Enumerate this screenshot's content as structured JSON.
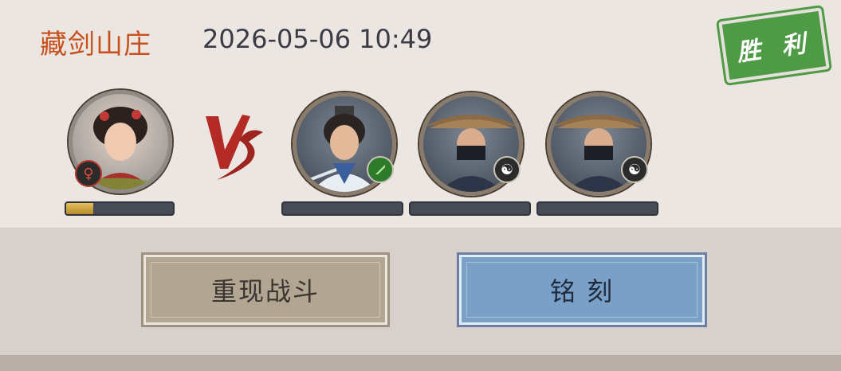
{
  "header": {
    "location": "藏剑山庄",
    "timestamp": "2026-05-06 10:49",
    "result_stamp": "胜 利"
  },
  "left_team": {
    "hero": {
      "icon": "heroine-portrait-icon",
      "badge": "♀",
      "badge_icon": "female-symbol-icon",
      "hp_fraction": 0.25
    }
  },
  "vs_label": "VS",
  "right_team": [
    {
      "icon": "swordsman-portrait-icon",
      "badge": "",
      "badge_icon": "green-blade-icon",
      "hp_fraction": 0
    },
    {
      "icon": "masked-straw-hat-portrait-icon",
      "badge": "☯",
      "badge_icon": "yin-yang-icon",
      "hp_fraction": 0
    },
    {
      "icon": "masked-straw-hat-portrait-icon",
      "badge": "☯",
      "badge_icon": "yin-yang-icon",
      "hp_fraction": 0
    }
  ],
  "buttons": {
    "replay": "重现战斗",
    "engrave": "铭 刻"
  },
  "colors": {
    "location": "#c8501c",
    "stamp": "#4f9a45",
    "replay_button": "#b2a692",
    "engrave_button": "#7aa0c8"
  }
}
